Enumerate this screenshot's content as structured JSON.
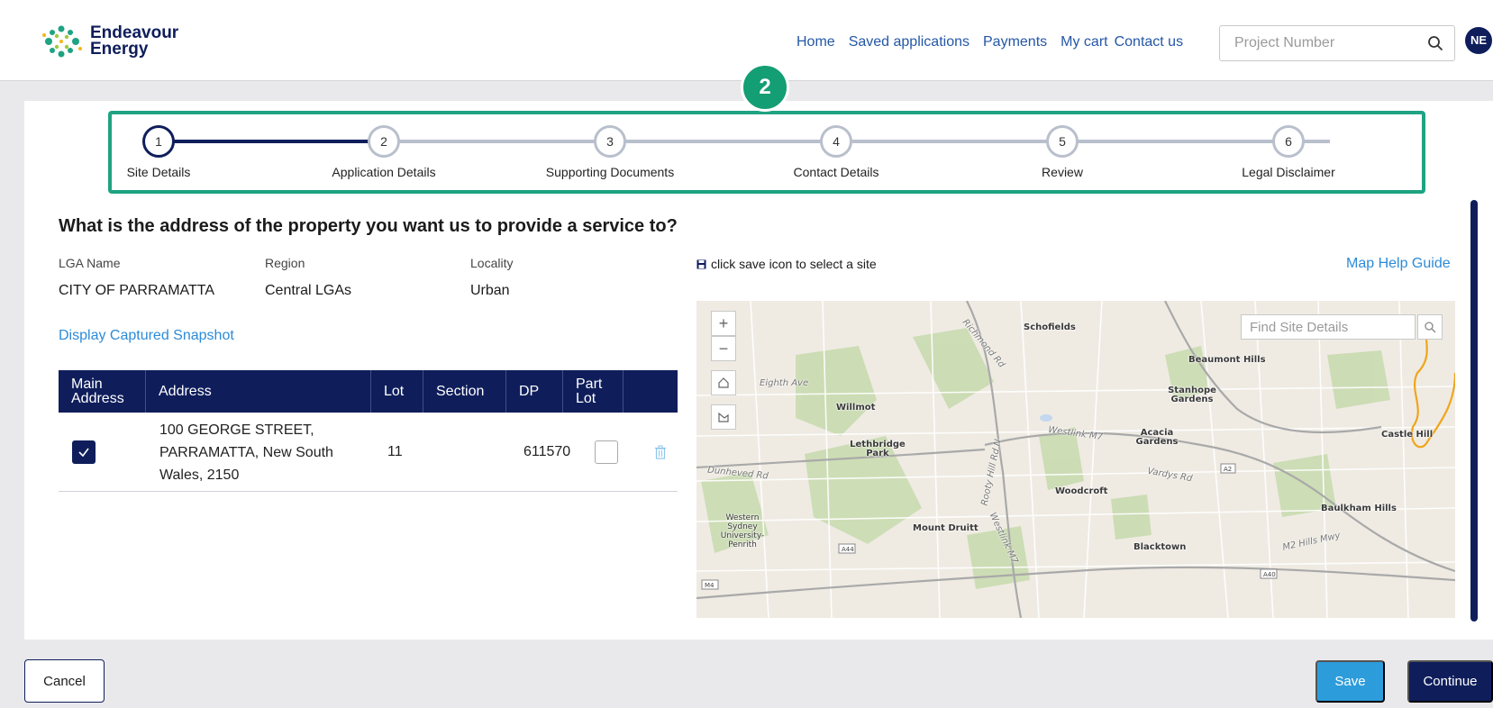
{
  "header": {
    "logo_line1": "Endeavour",
    "logo_line2": "Energy",
    "nav": [
      "Home",
      "Saved applications",
      "Payments",
      "My cart",
      "Contact us"
    ],
    "search_placeholder": "Project Number",
    "avatar_initials": "NE"
  },
  "callout_number": "2",
  "stepper": {
    "active_step": 1,
    "steps": [
      {
        "number": "1",
        "label": "Site Details"
      },
      {
        "number": "2",
        "label": "Application Details"
      },
      {
        "number": "3",
        "label": "Supporting Documents"
      },
      {
        "number": "4",
        "label": "Contact Details"
      },
      {
        "number": "5",
        "label": "Review"
      },
      {
        "number": "6",
        "label": "Legal Disclaimer"
      }
    ]
  },
  "question": "What is the address of the property you want us to provide a service to?",
  "info": {
    "lga_label": "LGA Name",
    "lga_value": "CITY OF PARRAMATTA",
    "region_label": "Region",
    "region_value": "Central LGAs",
    "locality_label": "Locality",
    "locality_value": "Urban"
  },
  "snapshot_link": "Display Captured Snapshot",
  "table": {
    "headers": [
      "Main Address",
      "Address",
      "Lot",
      "Section",
      "DP",
      "Part Lot"
    ],
    "rows": [
      {
        "main": true,
        "address": "100 GEORGE STREET, PARRAMATTA, New South Wales, 2150",
        "lot": "11",
        "section": "",
        "dp": "611570",
        "part_lot": false
      }
    ]
  },
  "map": {
    "hint": "click save icon to select a site",
    "help_link": "Map Help Guide",
    "search_placeholder": "Find Site Details",
    "places": [
      "Schofields",
      "Beaumont Hills",
      "Stanhope Gardens",
      "Willmot",
      "Lethbridge Park",
      "Acacia Gardens",
      "Castle Hill",
      "Woodcroft",
      "Baulkham Hills",
      "Mount Druitt",
      "Blacktown",
      "Western Sydney University- Penrith"
    ],
    "roads": [
      "Eighth Ave",
      "Richmond Rd",
      "Westlink M7",
      "Dunheved Rd",
      "Vardys Rd",
      "Rooty Hill Rd N",
      "Westlink M7",
      "M2 Hills Mwy"
    ],
    "shields": [
      "A2",
      "A44",
      "A40",
      "M4"
    ]
  },
  "footer": {
    "cancel": "Cancel",
    "save": "Save",
    "continue": "Continue"
  },
  "colors": {
    "navy": "#0f1e5b",
    "teal": "#1fa383",
    "link": "#2d8bd7",
    "save_button": "#2d9cdb"
  }
}
